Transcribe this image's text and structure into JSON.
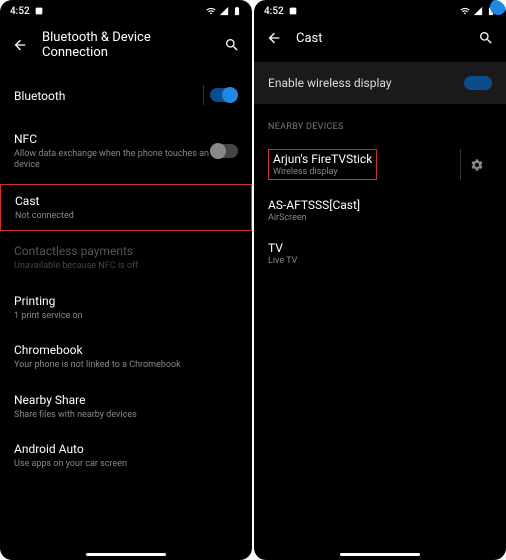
{
  "left": {
    "status": {
      "time": "4:52",
      "wifi": true,
      "signal": true,
      "battery": true
    },
    "header": {
      "title": "Bluetooth & Device Connection"
    },
    "items": {
      "bluetooth": {
        "title": "Bluetooth",
        "on": true
      },
      "nfc": {
        "title": "NFC",
        "sub": "Allow data exchange when the phone touches an NFC device",
        "on": false
      },
      "cast": {
        "title": "Cast",
        "sub": "Not connected"
      },
      "contactless": {
        "title": "Contactless payments",
        "sub": "Unavailable because NFC is off"
      },
      "printing": {
        "title": "Printing",
        "sub": "1 print service on"
      },
      "chromebook": {
        "title": "Chromebook",
        "sub": "Your phone is not linked to a Chromebook"
      },
      "nearby": {
        "title": "Nearby Share",
        "sub": "Share files with nearby devices"
      },
      "auto": {
        "title": "Android Auto",
        "sub": "Use apps on your car screen"
      }
    }
  },
  "right": {
    "status": {
      "time": "4:52"
    },
    "header": {
      "title": "Cast"
    },
    "enable": {
      "label": "Enable wireless display",
      "on": true
    },
    "section": "NEARBY DEVICES",
    "devices": [
      {
        "title": "Arjun's FireTVStick",
        "sub": "Wireless display"
      },
      {
        "title": "AS-AFTSSS[Cast]",
        "sub": "AirScreen"
      },
      {
        "title": "TV",
        "sub": "Live TV"
      }
    ]
  }
}
